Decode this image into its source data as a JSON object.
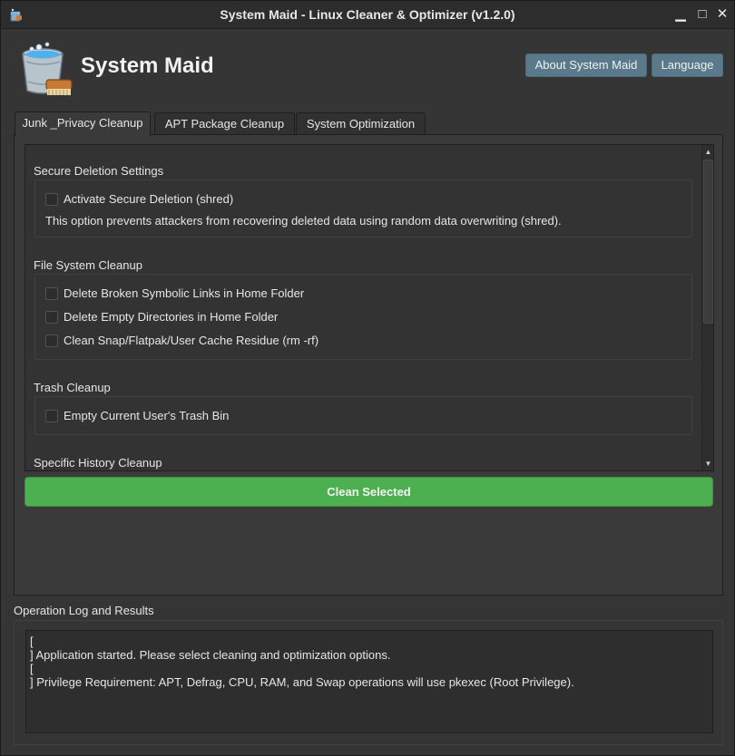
{
  "window": {
    "title": "System Maid - Linux Cleaner & Optimizer (v1.2.0)",
    "controls": {
      "minimize": "▁",
      "maximize": "□",
      "close": "✕"
    }
  },
  "header": {
    "app_name": "System Maid",
    "logo_icon": "bucket-brush-icon",
    "about_button": "About System Maid",
    "language_button": "Language"
  },
  "tabs": [
    {
      "label": "Junk _Privacy Cleanup",
      "active": true
    },
    {
      "label": "APT Package Cleanup",
      "active": false
    },
    {
      "label": "System Optimization",
      "active": false
    }
  ],
  "sections": {
    "secure_deletion": {
      "title": "Secure Deletion Settings",
      "option": "Activate Secure Deletion (shred)",
      "description": "This option prevents attackers from recovering deleted data using random data overwriting (shred)."
    },
    "file_system": {
      "title": "File System Cleanup",
      "options": [
        "Delete Broken Symbolic Links in Home Folder",
        "Delete Empty Directories in Home Folder",
        "Clean Snap/Flatpak/User Cache Residue (rm -rf)"
      ]
    },
    "trash": {
      "title": "Trash Cleanup",
      "option": "Empty Current User's Trash Bin"
    },
    "history": {
      "title": "Specific History Cleanup"
    }
  },
  "clean_button": "Clean Selected",
  "log": {
    "title": "Operation Log and Results",
    "content": "[\n] Application started. Please select cleaning and optimization options.\n[\n] Privilege Requirement: APT, Defrag, CPU, RAM, and Swap operations will use pkexec (Root Privilege)."
  },
  "colors": {
    "accent_green": "#4caf50",
    "header_button": "#5a7a8c",
    "background": "#353535"
  }
}
